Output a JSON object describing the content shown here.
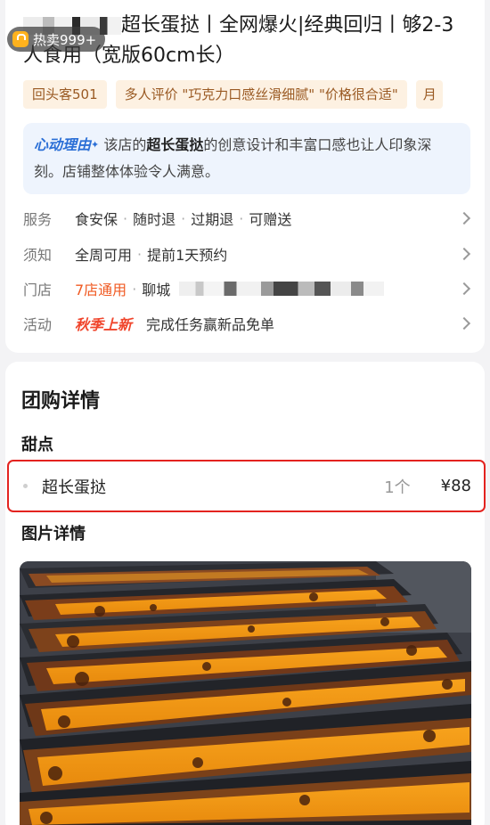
{
  "sales_badge": "热卖999+",
  "title": "超长蛋挞丨全网爆火|经典回归丨够2-3人食用（宽版60cm长）",
  "tags": [
    "回头客501",
    "多人评价 \"巧克力口感丝滑细腻\" \"价格很合适\"",
    "月"
  ],
  "reason": {
    "label": "心动理由",
    "text_before": "该店的",
    "highlight": "超长蛋挞",
    "text_after": "的创意设计和丰富口感也让人印象深刻。店铺整体体验令人满意。"
  },
  "info": {
    "service": {
      "key": "服务",
      "items": [
        "食安保",
        "随时退",
        "过期退",
        "可赠送"
      ]
    },
    "notice": {
      "key": "须知",
      "items": [
        "全周可用",
        "提前1天预约"
      ]
    },
    "store": {
      "key": "门店",
      "count": "7店通用",
      "city": "聊城"
    },
    "activity": {
      "key": "活动",
      "promo": "秋季上新",
      "text": "完成任务赢新品免单"
    }
  },
  "detail": {
    "title": "团购详情",
    "category": "甜点",
    "item": {
      "name": "超长蛋挞",
      "qty": "1个",
      "price": "¥88"
    },
    "pictures_title": "图片详情"
  },
  "colors": {
    "accent_orange": "#f05a22",
    "highlight_border": "#e3231f",
    "reason_bg": "#eef4fd",
    "tag_bg": "#fdf1e2"
  }
}
